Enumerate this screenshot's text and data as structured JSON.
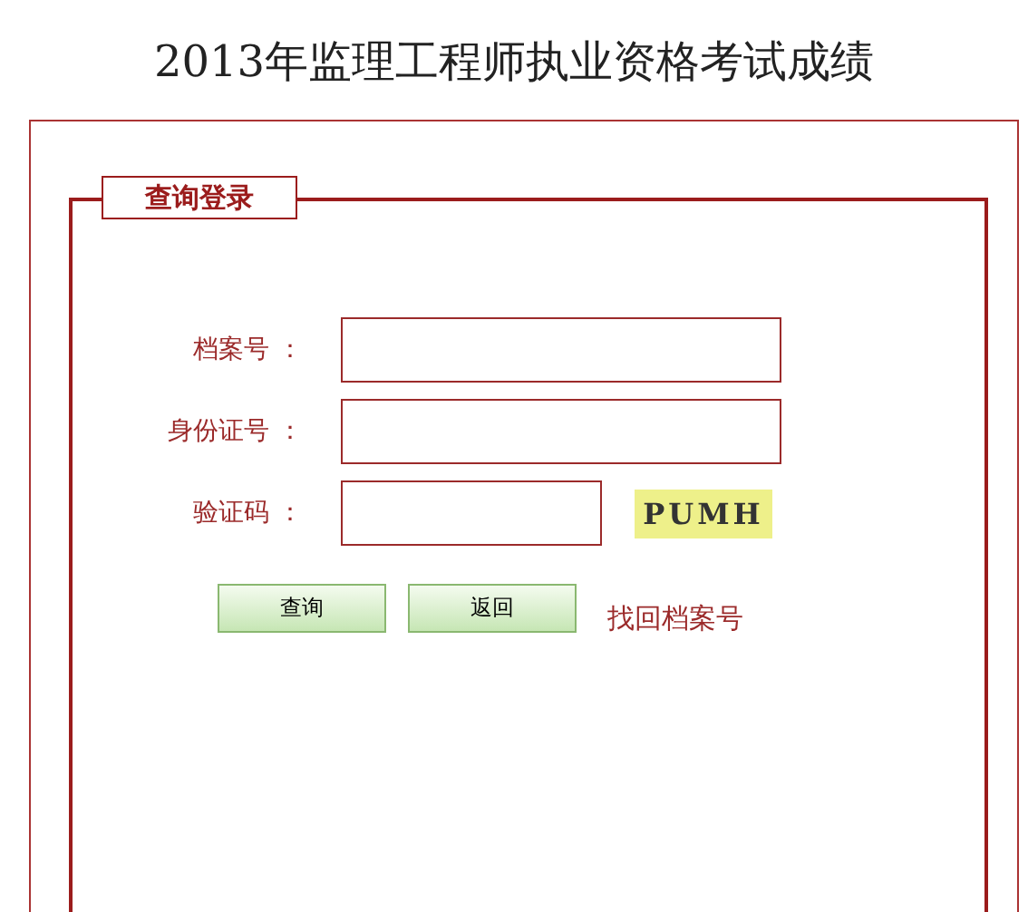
{
  "page_title": "2013年监理工程师执业资格考试成绩",
  "legend": "查询登录",
  "fields": [
    {
      "label": "档案号 ：",
      "kind": "text"
    },
    {
      "label": "身份证号 ：",
      "kind": "text"
    },
    {
      "label": "验证码 ：",
      "kind": "captcha",
      "captcha": "PUMH"
    }
  ],
  "buttons": [
    "查询",
    "返回"
  ],
  "link": "找回档案号"
}
